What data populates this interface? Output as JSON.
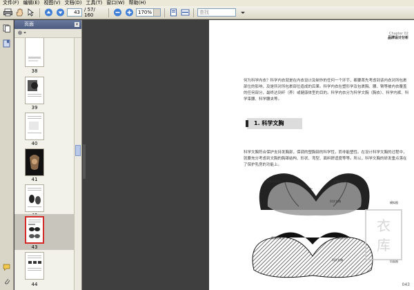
{
  "menu": [
    "文件(F)",
    "编辑(E)",
    "视图(V)",
    "文档(D)",
    "工具(T)",
    "窗口(W)",
    "帮助(H)"
  ],
  "toolbar": {
    "current_page": "43",
    "page_total": "/ 57/ 160",
    "zoom": "170%",
    "search_placeholder": "查找"
  },
  "panel": {
    "title": "页面",
    "close": "×",
    "thumbnails": [
      {
        "label": "38"
      },
      {
        "label": "39"
      },
      {
        "label": "40"
      },
      {
        "label": "41"
      },
      {
        "label": "42"
      },
      {
        "label": "43",
        "selected": true
      },
      {
        "label": "44"
      }
    ]
  },
  "page": {
    "chapter_line1": "Chapter 02",
    "chapter_line2": "品牌设计分析",
    "intro": "何为科学内衣？科学内衣就是在内衣设计及制作的任何一个环节，都要首先考虑到该内衣对所包裹部位的影响，及是所对所包裹部位造成的后果。科学内衣在塑形学及包裹胸、腰、臀等被内衣覆盖的任何部分，最终达到纤（养）或健康体型的目的。科学内衣分为科学文胸（胸衣）、科学内裤、科学束腰、科学腰夹等。",
    "section_title": "1. 科学文胸",
    "body": "科学文胸符合保护支持发胸部，保调的塑胸部的科学性，而非能塑性。在设计科学文胸的过程中，就要充分考虑到文胸的胸罩结构、形状、弯型、面料舒适度等等。所以，科学文胸的研发重点落在了保护乳房的功能上。",
    "fig_labels": [
      "真我的乳房",
      "文胸的托杯",
      "科学文胸",
      "模拟图",
      "真我的乳房",
      "文胸的托杯",
      "科学文胸",
      "切面图"
    ],
    "page_number": "043"
  }
}
